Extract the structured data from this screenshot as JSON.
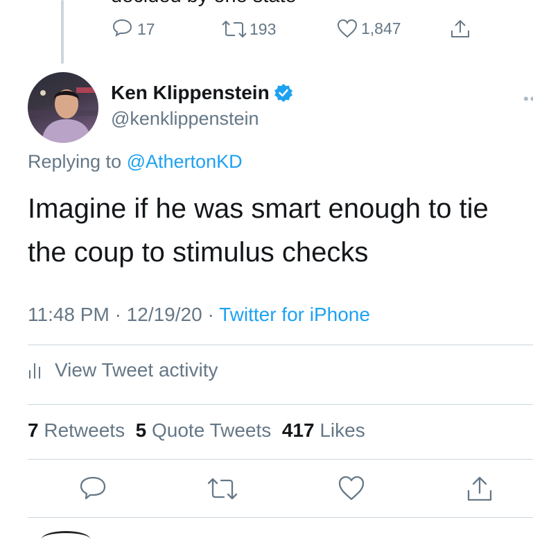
{
  "parent_tweet": {
    "cut_text": "decided by one state",
    "reply_count": "17",
    "retweet_count": "193",
    "like_count": "1,847"
  },
  "tweet": {
    "author_name": "Ken Klippenstein",
    "author_handle": "@kenklippenstein",
    "verified": true,
    "replying_to_prefix": "Replying to",
    "replying_to_handle": "@AthertonKD",
    "text_line1": "Imagine if he was smart enough to tie",
    "text_line2": "the coup to stimulus checks",
    "time": "11:48 PM",
    "date": "12/19/20",
    "source": "Twitter for iPhone",
    "separator": "·"
  },
  "activity_label": "View Tweet activity",
  "stats": {
    "retweets_count": "7",
    "retweets_label": "Retweets",
    "quotes_count": "5",
    "quotes_label": "Quote Tweets",
    "likes_count": "417",
    "likes_label": "Likes"
  },
  "colors": {
    "link_blue": "#1da1f2",
    "secondary_text": "#657786",
    "primary_text": "#14171a",
    "divider": "#ccd6dd"
  },
  "icons": [
    "reply-icon",
    "retweet-icon",
    "like-icon",
    "share-icon",
    "verified-badge-icon",
    "activity-bars-icon",
    "more-icon"
  ]
}
